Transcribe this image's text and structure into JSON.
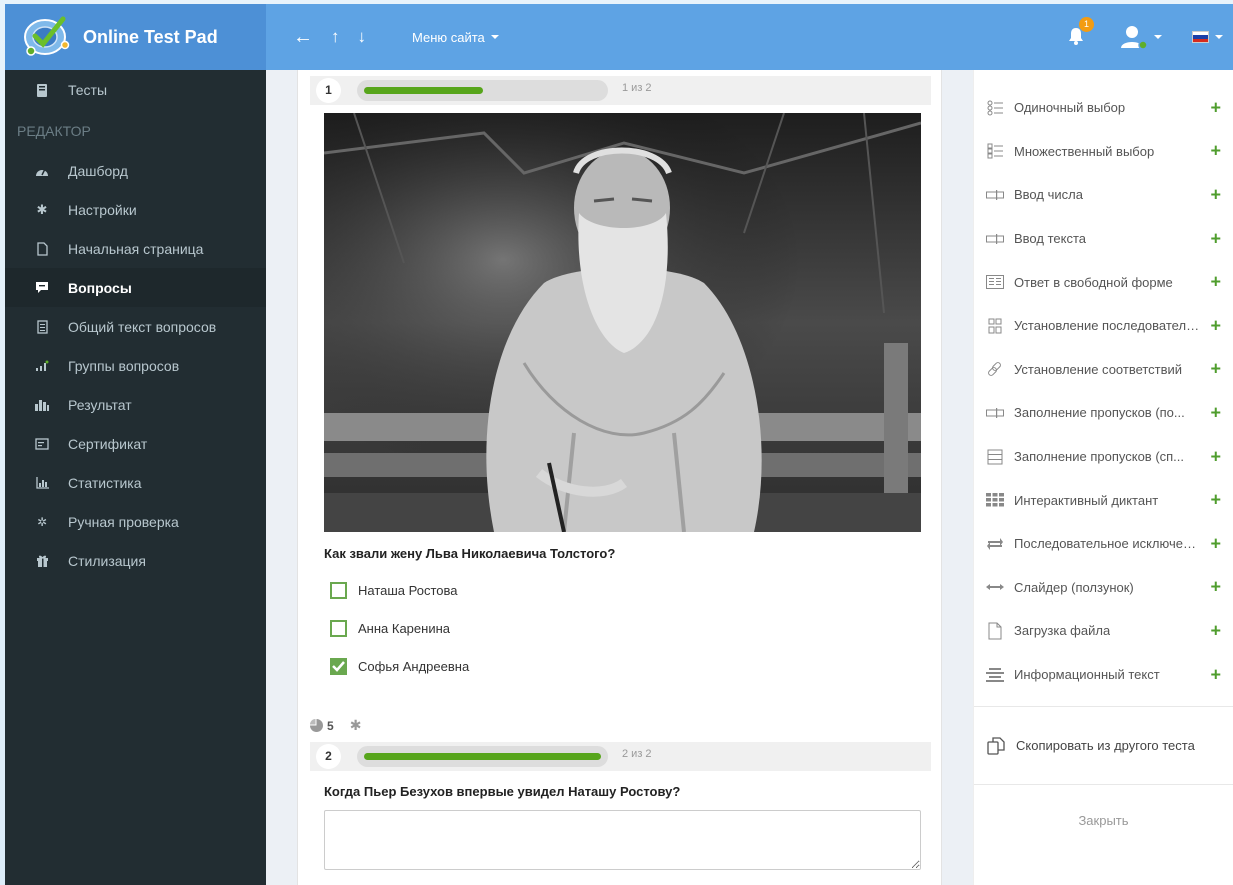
{
  "header": {
    "app_title": "Online Test Pad",
    "site_menu_label": "Меню сайта",
    "notification_count": "1",
    "nav": {
      "back_icon": "arrow-left-icon",
      "up_icon": "arrow-up-icon",
      "down_icon": "arrow-down-icon"
    }
  },
  "sidebar": {
    "tests_label": "Тесты",
    "section_header": "РЕДАКТОР",
    "items": [
      {
        "label": "Дашборд",
        "icon": "dashboard-icon"
      },
      {
        "label": "Настройки",
        "icon": "gear-icon"
      },
      {
        "label": "Начальная страница",
        "icon": "file-icon"
      },
      {
        "label": "Вопросы",
        "icon": "comment-icon",
        "active": true
      },
      {
        "label": "Общий текст вопросов",
        "icon": "document-icon"
      },
      {
        "label": "Группы вопросов",
        "icon": "groups-icon"
      },
      {
        "label": "Результат",
        "icon": "bar-chart-icon"
      },
      {
        "label": "Сертификат",
        "icon": "certificate-icon"
      },
      {
        "label": "Статистика",
        "icon": "statistics-icon"
      },
      {
        "label": "Ручная проверка",
        "icon": "cogs-icon"
      },
      {
        "label": "Стилизация",
        "icon": "gift-icon"
      }
    ]
  },
  "questions": [
    {
      "number": "1",
      "progress_text": "1 из 2",
      "progress": 0.5,
      "text": "Как звали жену Льва Николаевича Толстого?",
      "options": [
        {
          "label": "Наташа Ростова",
          "checked": false
        },
        {
          "label": "Анна Каренина",
          "checked": false
        },
        {
          "label": "Софья Андреевна",
          "checked": true
        }
      ]
    },
    {
      "number": "2",
      "progress_text": "2 из 2",
      "progress": 1.0,
      "text": "Когда Пьер Безухов впервые увидел Наташу Ростову?",
      "answer_value": ""
    }
  ],
  "question_meta": {
    "points": "5"
  },
  "right_panel": {
    "items": [
      {
        "label": "Одиночный выбор",
        "icon": "single-choice-icon"
      },
      {
        "label": "Множественный выбор",
        "icon": "multiple-choice-icon"
      },
      {
        "label": "Ввод числа",
        "icon": "input-number-icon"
      },
      {
        "label": "Ввод текста",
        "icon": "input-text-icon"
      },
      {
        "label": "Ответ в свободной форме",
        "icon": "free-answer-icon"
      },
      {
        "label": "Установление последовательности",
        "icon": "sequence-icon"
      },
      {
        "label": "Установление соответствий",
        "icon": "link-icon"
      },
      {
        "label": "Заполнение пропусков (по...",
        "icon": "fill-gaps-icon"
      },
      {
        "label": "Заполнение пропусков (сп...",
        "icon": "fill-gaps-list-icon"
      },
      {
        "label": "Интерактивный диктант",
        "icon": "dictation-icon"
      },
      {
        "label": "Последовательное исключение",
        "icon": "exclusion-icon"
      },
      {
        "label": "Слайдер (ползунок)",
        "icon": "slider-icon"
      },
      {
        "label": "Загрузка файла",
        "icon": "file-upload-icon"
      },
      {
        "label": "Информационный текст",
        "icon": "info-text-icon"
      }
    ],
    "copy_label": "Скопировать из другого теста",
    "close_label": "Закрыть"
  },
  "colors": {
    "header": "#5ea3e4",
    "logo_bg": "#4d90d6",
    "sidebar": "#222d32",
    "accent_green": "#57a51b",
    "add_green": "#4f9d2d"
  }
}
